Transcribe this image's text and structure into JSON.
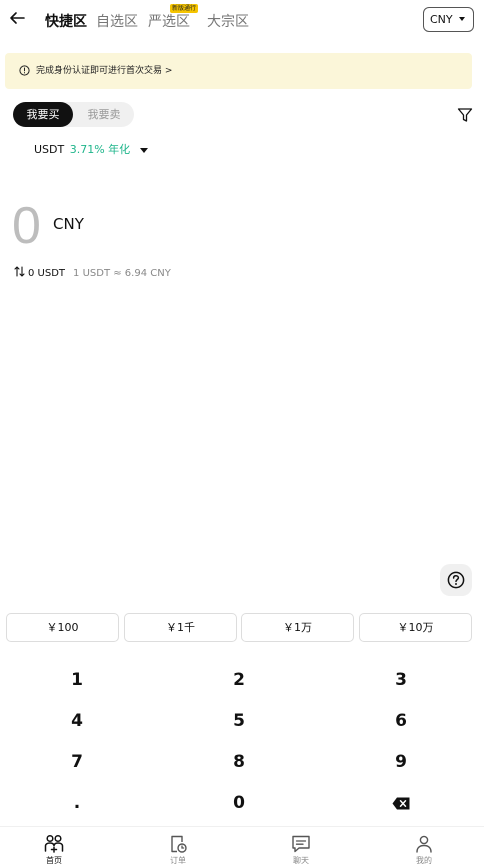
{
  "header": {
    "tabs": [
      {
        "label": "快捷区",
        "active": true
      },
      {
        "label": "自选区",
        "active": false
      },
      {
        "label": "严选区",
        "active": false
      },
      {
        "label": "大宗区",
        "active": false
      }
    ],
    "tab_badge": "新版通行",
    "currency": "CNY"
  },
  "notice": {
    "text": "完成身份认证即可进行首次交易 >"
  },
  "segment": {
    "buy": "我要买",
    "sell": "我要卖"
  },
  "coin": {
    "symbol": "USDT",
    "apy": "3.71% 年化"
  },
  "amount": {
    "value": "0",
    "currency": "CNY"
  },
  "conversion": {
    "usdt": "0 USDT",
    "rate": "1 USDT ≈ 6.94 CNY"
  },
  "quick_amounts": [
    "￥100",
    "￥1千",
    "￥1万",
    "￥10万"
  ],
  "keypad": {
    "keys": [
      "1",
      "2",
      "3",
      "4",
      "5",
      "6",
      "7",
      "8",
      "9",
      ".",
      "0"
    ]
  },
  "bottom_nav": [
    {
      "label": "首页",
      "icon": "home-people-icon",
      "active": true
    },
    {
      "label": "订单",
      "icon": "order-clock-icon",
      "active": false
    },
    {
      "label": "聊天",
      "icon": "chat-icon",
      "active": false
    },
    {
      "label": "我的",
      "icon": "user-icon",
      "active": false
    }
  ],
  "colors": {
    "apy_green": "#1fb58b",
    "notice_bg": "#fbf6d9",
    "badge_yellow": "#f5c400"
  }
}
